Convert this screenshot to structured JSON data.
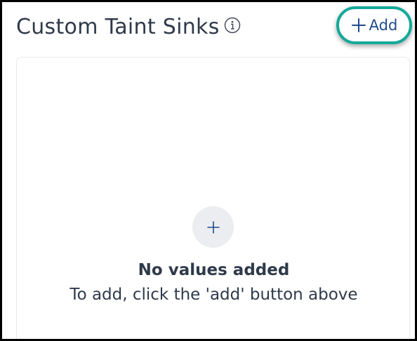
{
  "section": {
    "title": "Custom Taint Sinks",
    "info_icon": "info-icon",
    "add_button": {
      "label": "Add",
      "icon": "plus-icon",
      "highlight_color": "#14a99a"
    }
  },
  "empty_state": {
    "icon": "plus-icon",
    "title": "No values added",
    "subtitle": "To add, click the 'add' button above"
  },
  "colors": {
    "text": "#2f3a4a",
    "link": "#1f4b8e",
    "highlight": "#14a99a",
    "circle_bg": "#ebedf0"
  }
}
